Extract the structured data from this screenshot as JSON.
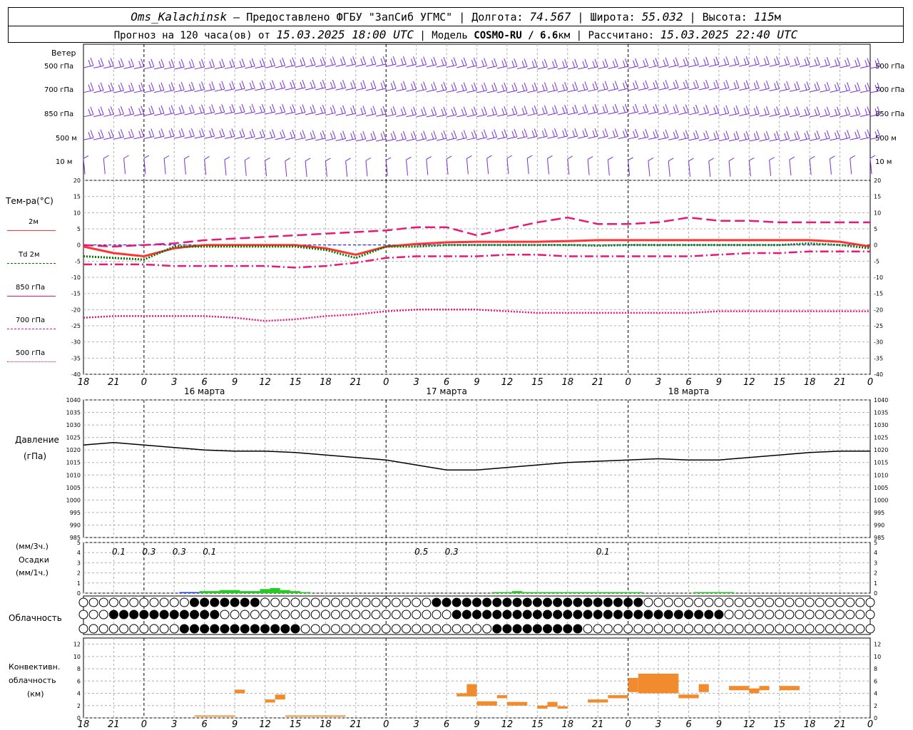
{
  "header": {
    "station": "Oms_Kalachinsk",
    "dash": " – ",
    "provided": "Предоставлено ФГБУ \"ЗапСиб УГМС\"",
    "lon_label": "Долгота:",
    "lon": "74.567",
    "lat_label": "Широта:",
    "lat": "55.032",
    "alt_label": "Высота:",
    "alt": "115",
    "alt_unit": "м",
    "forecast_label": "Прогноз на 120 часа(ов) от",
    "forecast_time": "15.03.2025 18:00 UTC",
    "model_label": "| Модель",
    "model": "COSMO-RU / 6.6",
    "model_unit": "км",
    "calc_label": "| Рассчитано:",
    "calc_time": "15.03.2025 22:40 UTC"
  },
  "time_axis": {
    "hour_labels": [
      "18",
      "21",
      "0",
      "3",
      "6",
      "9",
      "12",
      "15",
      "18",
      "21",
      "0",
      "3",
      "6",
      "9",
      "12",
      "15",
      "18",
      "21",
      "0",
      "3",
      "6",
      "9",
      "12",
      "15",
      "18",
      "21",
      "0"
    ],
    "day_labels": [
      {
        "text": "16 марта",
        "hour": 12
      },
      {
        "text": "17 марта",
        "hour": 36
      },
      {
        "text": "18 марта",
        "hour": 60
      }
    ]
  },
  "panels": {
    "wind": {
      "title": "Ветер",
      "levels": [
        "500 гПа",
        "700 гПа",
        "850 гПа",
        "500 м",
        "10 м"
      ]
    },
    "temperature": {
      "title": "Тем-ра(°C)",
      "legend": [
        {
          "label": "2м",
          "color": "#ff3333",
          "style": "solid"
        },
        {
          "label": "Td 2м",
          "color": "#007700",
          "style": "dotted"
        },
        {
          "label": "850 гПа",
          "color": "#e6197a",
          "style": "dashed"
        },
        {
          "label": "700 гПа",
          "color": "#e6197a",
          "style": "dashdot"
        },
        {
          "label": "500 гПа",
          "color": "#e6197a",
          "style": "dotted"
        }
      ],
      "ylim": [
        -40,
        20
      ],
      "ticks": [
        "20",
        "15",
        "10",
        "5",
        "0",
        "-5",
        "-10",
        "-15",
        "-20",
        "-25",
        "-30",
        "-35",
        "-40"
      ]
    },
    "pressure": {
      "title": "Давление",
      "unit": "(гПа)",
      "ylim": [
        985,
        1040
      ],
      "ticks": [
        "1040",
        "1035",
        "1030",
        "1025",
        "1020",
        "1015",
        "1010",
        "1005",
        "1000",
        "995",
        "990",
        "985"
      ]
    },
    "precip": {
      "title": "Осадки",
      "unit_top": "(мм/3ч.)",
      "unit_bottom": "(мм/1ч.)",
      "ticks": [
        "5",
        "4",
        "3",
        "2",
        "1",
        "0"
      ],
      "totals": [
        {
          "text": "0.1",
          "hour": 3.5
        },
        {
          "text": "0.3",
          "hour": 6.5
        },
        {
          "text": "0.3",
          "hour": 9.5
        },
        {
          "text": "0.1",
          "hour": 12.5
        },
        {
          "text": "0.5",
          "hour": 33.5
        },
        {
          "text": "0.3",
          "hour": 36.5
        },
        {
          "text": "0.1",
          "hour": 51.5
        }
      ]
    },
    "cloud": {
      "title": "Облачность"
    },
    "convective": {
      "title_1": "Конвективн.",
      "title_2": "облачность",
      "unit": "(км)",
      "ylim": [
        0,
        13
      ],
      "ticks": [
        "12",
        "10",
        "8",
        "6",
        "4",
        "2",
        "0"
      ]
    }
  },
  "chart_data": [
    {
      "type": "line",
      "title": "Тем-ра(°C)",
      "x": [
        0,
        3,
        6,
        9,
        12,
        15,
        18,
        21,
        24,
        27,
        30,
        33,
        36,
        39,
        42,
        45,
        48,
        51,
        54,
        57,
        60,
        63,
        66,
        69,
        72,
        75,
        78
      ],
      "ylim": [
        -40,
        20
      ],
      "series": [
        {
          "name": "2м",
          "values": [
            -0.5,
            -2.5,
            -3.5,
            -1,
            0,
            0,
            0,
            0,
            -1,
            -3,
            -0.5,
            0.3,
            0.8,
            1,
            1,
            1,
            1.2,
            1.5,
            1.5,
            1.5,
            1.5,
            1.5,
            1.5,
            1.5,
            1.5,
            1,
            -0.5
          ]
        },
        {
          "name": "Td 2м",
          "values": [
            -3.5,
            -4,
            -4.5,
            -0.5,
            -0.5,
            -0.5,
            -0.5,
            -0.5,
            -1.5,
            -4,
            -0.5,
            -0.5,
            0,
            0,
            0,
            0,
            0,
            -0.2,
            0,
            0,
            0,
            0,
            0,
            0,
            0.5,
            0,
            -1
          ]
        },
        {
          "name": "850 гПа",
          "values": [
            0,
            -0.5,
            0,
            0.5,
            1.5,
            2,
            2.5,
            3,
            3.5,
            4,
            4.5,
            5.5,
            5.5,
            3,
            5,
            7,
            8.5,
            6.5,
            6.5,
            7,
            8.5,
            7.5,
            7.5,
            7,
            7,
            7,
            7
          ]
        },
        {
          "name": "700 гПа",
          "values": [
            -6,
            -6,
            -6,
            -6.5,
            -6.5,
            -6.5,
            -6.5,
            -7,
            -6.5,
            -5.5,
            -4,
            -3.5,
            -3.5,
            -3.5,
            -3,
            -3,
            -3.5,
            -3.5,
            -3.5,
            -3.5,
            -3.5,
            -3,
            -2.5,
            -2.5,
            -2,
            -2,
            -2
          ]
        },
        {
          "name": "500 гПа",
          "values": [
            -22.5,
            -22,
            -22,
            -22,
            -22,
            -22.5,
            -23.5,
            -23,
            -22,
            -21.5,
            -20.5,
            -20,
            -20,
            -20,
            -20.5,
            -21,
            -21,
            -21,
            -21,
            -21,
            -21,
            -20.5,
            -20.5,
            -20.5,
            -20.5,
            -20.5,
            -20.5
          ]
        }
      ]
    },
    {
      "type": "line",
      "title": "Давление",
      "x": [
        0,
        3,
        6,
        9,
        12,
        15,
        18,
        21,
        24,
        27,
        30,
        33,
        36,
        39,
        42,
        45,
        48,
        51,
        54,
        57,
        60,
        63,
        66,
        69,
        72,
        75,
        78
      ],
      "ylim": [
        985,
        1040
      ],
      "series": [
        {
          "name": "Давление",
          "values": [
            1022,
            1023,
            1022,
            1021,
            1020,
            1019.5,
            1019.5,
            1019,
            1018,
            1017,
            1016,
            1014,
            1012,
            1012,
            1013,
            1014,
            1015,
            1015.5,
            1016,
            1016.5,
            1016,
            1016,
            1017,
            1018,
            1019,
            1019.5,
            1019.5
          ]
        }
      ]
    },
    {
      "type": "bar",
      "title": "Осадки",
      "x": [
        10,
        11,
        12,
        13,
        14,
        15,
        16,
        17,
        18,
        19,
        20,
        21,
        22,
        41,
        42,
        43,
        44,
        45,
        46,
        47,
        48,
        49,
        50,
        51,
        52,
        53,
        54,
        55,
        61,
        62,
        63,
        64
      ],
      "ylim": [
        0,
        5
      ],
      "series": [
        {
          "name": "мм/1ч",
          "values": [
            0.1,
            0.1,
            0.2,
            0.2,
            0.3,
            0.3,
            0.2,
            0.2,
            0.4,
            0.5,
            0.3,
            0.2,
            0.1,
            0.1,
            0.1,
            0.2,
            0.1,
            0.1,
            0.1,
            0.1,
            0.1,
            0.1,
            0.1,
            0.1,
            0.1,
            0.1,
            0.1,
            0.1,
            0.1,
            0.1,
            0.1,
            0.1
          ]
        }
      ]
    },
    {
      "type": "bar",
      "title": "Конвективн. облачность",
      "ylim": [
        0,
        13
      ],
      "bars": [
        {
          "h0": 11,
          "h1": 15,
          "bottom": 0.2,
          "top": 0.4
        },
        {
          "h0": 15,
          "h1": 16,
          "bottom": 4,
          "top": 4.6
        },
        {
          "h0": 18,
          "h1": 19,
          "bottom": 2.5,
          "top": 3
        },
        {
          "h0": 19,
          "h1": 20,
          "bottom": 3,
          "top": 3.8
        },
        {
          "h0": 20,
          "h1": 26,
          "bottom": 0.2,
          "top": 0.4
        },
        {
          "h0": 37,
          "h1": 38,
          "bottom": 3.5,
          "top": 4
        },
        {
          "h0": 38,
          "h1": 39,
          "bottom": 3.5,
          "top": 5.5
        },
        {
          "h0": 39,
          "h1": 41,
          "bottom": 2,
          "top": 2.7
        },
        {
          "h0": 41,
          "h1": 42,
          "bottom": 3.2,
          "top": 3.7
        },
        {
          "h0": 42,
          "h1": 44,
          "bottom": 2,
          "top": 2.6
        },
        {
          "h0": 45,
          "h1": 46,
          "bottom": 1.5,
          "top": 2
        },
        {
          "h0": 46,
          "h1": 47,
          "bottom": 1.8,
          "top": 2.6
        },
        {
          "h0": 47,
          "h1": 48,
          "bottom": 1.5,
          "top": 1.9
        },
        {
          "h0": 50,
          "h1": 52,
          "bottom": 2.5,
          "top": 3
        },
        {
          "h0": 52,
          "h1": 54,
          "bottom": 3.2,
          "top": 3.7
        },
        {
          "h0": 54,
          "h1": 55,
          "bottom": 4.2,
          "top": 6.5
        },
        {
          "h0": 55,
          "h1": 59,
          "bottom": 4,
          "top": 7.2
        },
        {
          "h0": 59,
          "h1": 61,
          "bottom": 3.2,
          "top": 3.8
        },
        {
          "h0": 61,
          "h1": 62,
          "bottom": 4.2,
          "top": 5.5
        },
        {
          "h0": 64,
          "h1": 66,
          "bottom": 4.5,
          "top": 5.2
        },
        {
          "h0": 66,
          "h1": 67,
          "bottom": 4,
          "top": 4.8
        },
        {
          "h0": 67,
          "h1": 68,
          "bottom": 4.5,
          "top": 5.2
        },
        {
          "h0": 69,
          "h1": 71,
          "bottom": 4.5,
          "top": 5.2
        }
      ]
    }
  ]
}
